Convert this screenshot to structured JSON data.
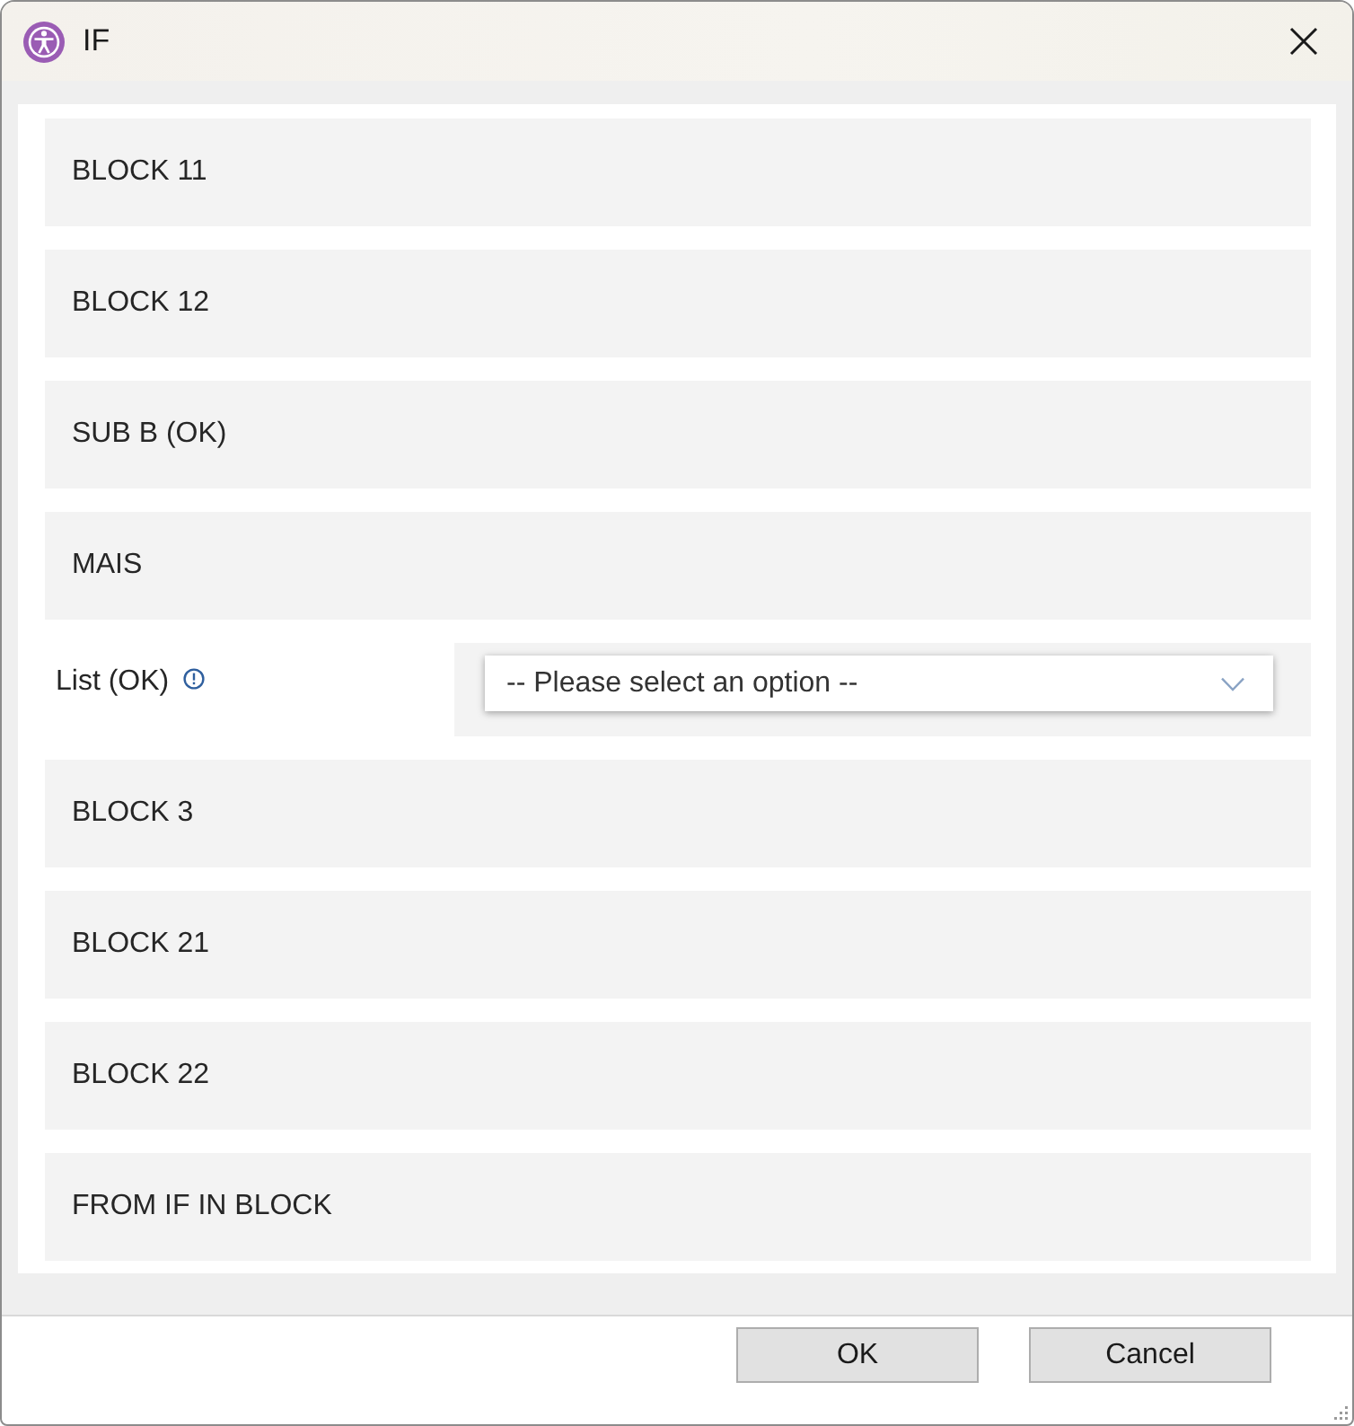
{
  "window": {
    "title": "IF"
  },
  "rows": [
    {
      "kind": "block",
      "label": "BLOCK 11"
    },
    {
      "kind": "block",
      "label": "BLOCK 12"
    },
    {
      "kind": "block",
      "label": "SUB B (OK)"
    },
    {
      "kind": "block",
      "label": "MAIS"
    },
    {
      "kind": "select",
      "label": "List (OK)",
      "placeholder": "-- Please select an option --"
    },
    {
      "kind": "block",
      "label": "BLOCK 3"
    },
    {
      "kind": "block",
      "label": "BLOCK 21"
    },
    {
      "kind": "block",
      "label": "BLOCK 22"
    },
    {
      "kind": "block",
      "label": "FROM IF IN BLOCK"
    }
  ],
  "buttons": [
    {
      "label": "OK"
    },
    {
      "label": "Cancel"
    }
  ]
}
